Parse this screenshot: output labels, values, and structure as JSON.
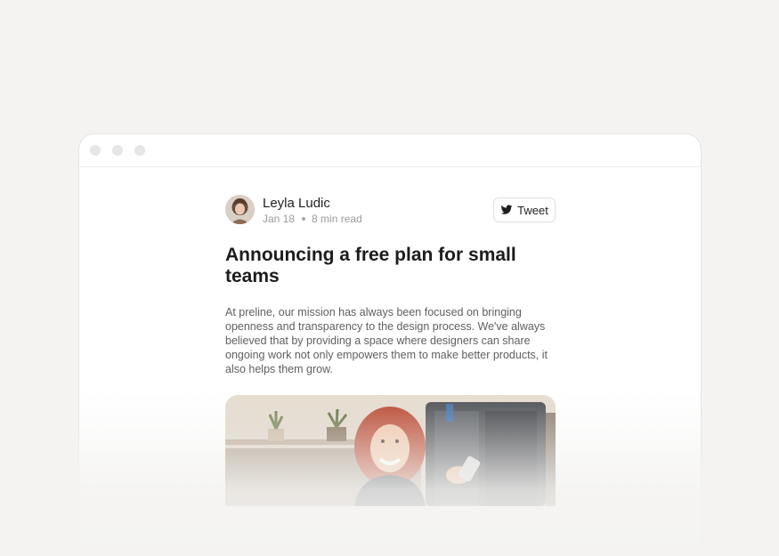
{
  "author": {
    "name": "Leyla Ludic",
    "date": "Jan 18",
    "read_time": "8 min read",
    "avatar_icon": "avatar"
  },
  "actions": {
    "tweet_label": "Tweet",
    "tweet_icon": "twitter-icon"
  },
  "article": {
    "title": "Announcing a free plan for small teams",
    "body": "At preline, our mission has always been focused on bringing openness and transparency to the design process. We've always believed that by providing a space where designers can share ongoing work not only empowers them to make better products, it also helps them grow."
  },
  "colors": {
    "background": "#f4f3f1",
    "window": "#ffffff",
    "text_primary": "#1c1c1c",
    "text_secondary": "#5f5f5f",
    "text_muted": "#9a9a9a"
  }
}
